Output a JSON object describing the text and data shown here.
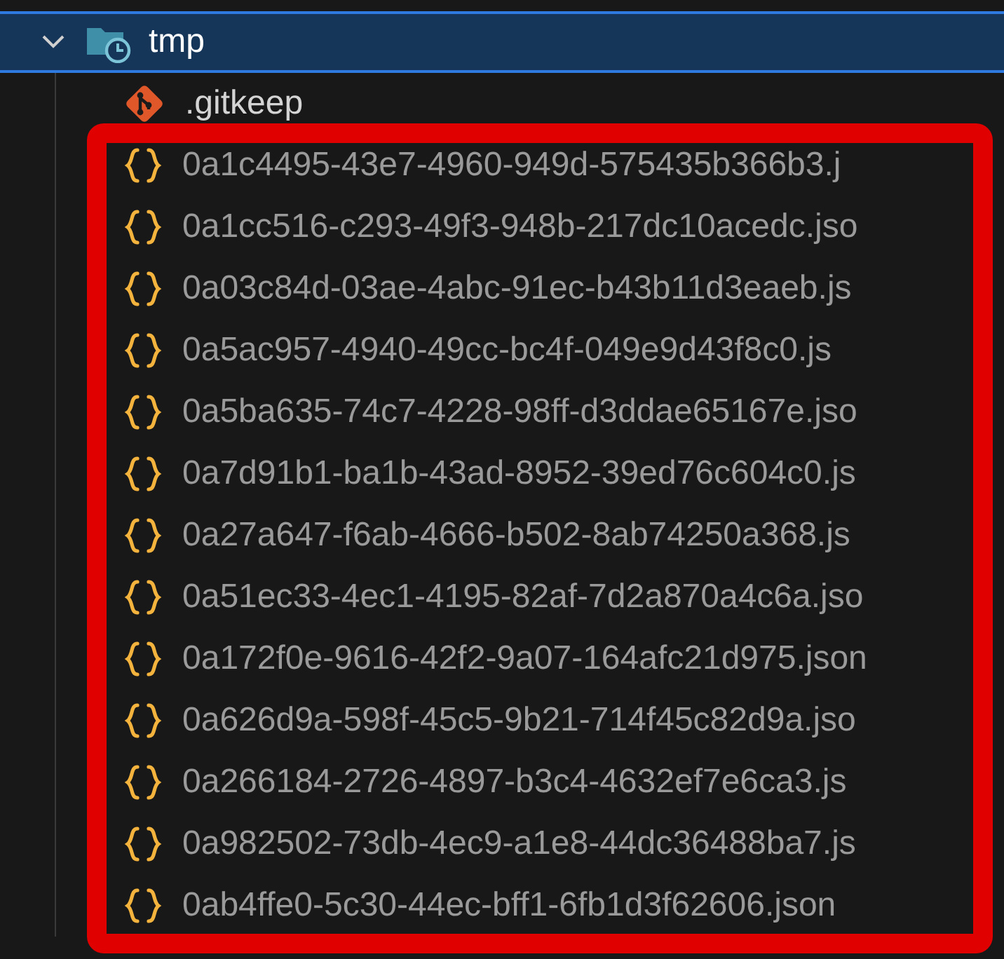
{
  "explorer": {
    "folder": {
      "name": "tmp",
      "expanded": true,
      "selected": true,
      "children": [
        {
          "name": ".gitkeep",
          "kind": "git"
        },
        {
          "name": "0a1c4495-43e7-4960-949d-575435b366b3.j",
          "kind": "json"
        },
        {
          "name": "0a1cc516-c293-49f3-948b-217dc10acedc.jso",
          "kind": "json"
        },
        {
          "name": "0a03c84d-03ae-4abc-91ec-b43b11d3eaeb.js",
          "kind": "json"
        },
        {
          "name": "0a5ac957-4940-49cc-bc4f-049e9d43f8c0.js",
          "kind": "json"
        },
        {
          "name": "0a5ba635-74c7-4228-98ff-d3ddae65167e.jso",
          "kind": "json"
        },
        {
          "name": "0a7d91b1-ba1b-43ad-8952-39ed76c604c0.js",
          "kind": "json"
        },
        {
          "name": "0a27a647-f6ab-4666-b502-8ab74250a368.js",
          "kind": "json"
        },
        {
          "name": "0a51ec33-4ec1-4195-82af-7d2a870a4c6a.jso",
          "kind": "json"
        },
        {
          "name": "0a172f0e-9616-42f2-9a07-164afc21d975.json",
          "kind": "json"
        },
        {
          "name": "0a626d9a-598f-45c5-9b21-714f45c82d9a.jso",
          "kind": "json"
        },
        {
          "name": "0a266184-2726-4897-b3c4-4632ef7e6ca3.js",
          "kind": "json"
        },
        {
          "name": "0a982502-73db-4ec9-a1e8-44dc36488ba7.js",
          "kind": "json"
        },
        {
          "name": "0ab4ffe0-5c30-44ec-bff1-6fb1d3f62606.json",
          "kind": "json"
        }
      ]
    }
  }
}
